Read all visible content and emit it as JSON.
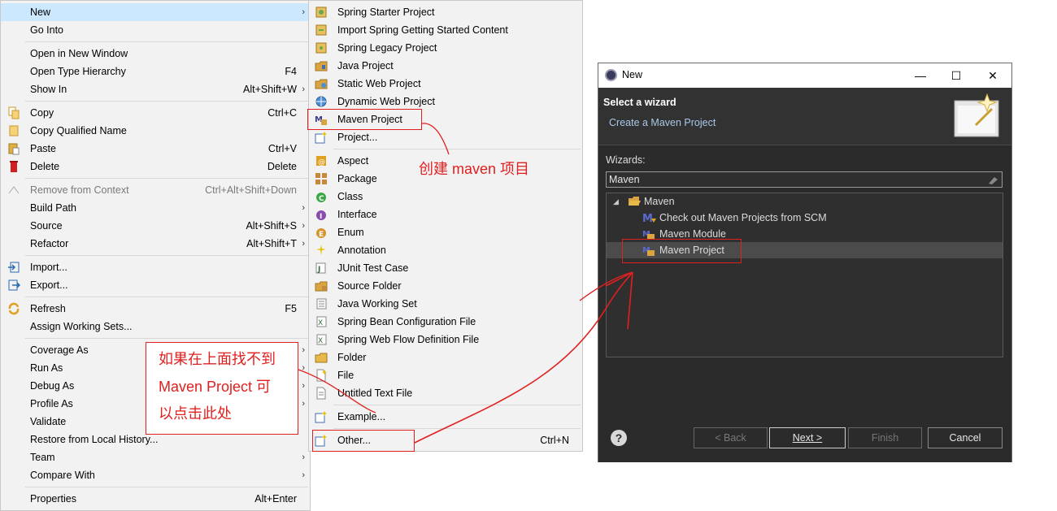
{
  "context_menu": {
    "items": [
      {
        "label": "New",
        "shortcut": "",
        "submenu": true,
        "icon": ""
      },
      {
        "label": "Go Into",
        "shortcut": "",
        "submenu": false,
        "icon": ""
      },
      {
        "label": "Open in New Window",
        "shortcut": "",
        "submenu": false,
        "icon": ""
      },
      {
        "label": "Open Type Hierarchy",
        "shortcut": "F4",
        "submenu": false,
        "icon": ""
      },
      {
        "label": "Show In",
        "shortcut": "Alt+Shift+W",
        "submenu": true,
        "icon": ""
      },
      {
        "label": "Copy",
        "shortcut": "Ctrl+C",
        "submenu": false,
        "icon": "copy-icon"
      },
      {
        "label": "Copy Qualified Name",
        "shortcut": "",
        "submenu": false,
        "icon": "copy-qualified-icon"
      },
      {
        "label": "Paste",
        "shortcut": "Ctrl+V",
        "submenu": false,
        "icon": "paste-icon"
      },
      {
        "label": "Delete",
        "shortcut": "Delete",
        "submenu": false,
        "icon": "delete-icon"
      },
      {
        "label": "Remove from Context",
        "shortcut": "Ctrl+Alt+Shift+Down",
        "submenu": false,
        "icon": "remove-context-icon",
        "disabled": true
      },
      {
        "label": "Build Path",
        "shortcut": "",
        "submenu": true,
        "icon": ""
      },
      {
        "label": "Source",
        "shortcut": "Alt+Shift+S",
        "submenu": true,
        "icon": ""
      },
      {
        "label": "Refactor",
        "shortcut": "Alt+Shift+T",
        "submenu": true,
        "icon": ""
      },
      {
        "label": "Import...",
        "shortcut": "",
        "submenu": false,
        "icon": "import-icon"
      },
      {
        "label": "Export...",
        "shortcut": "",
        "submenu": false,
        "icon": "export-icon"
      },
      {
        "label": "Refresh",
        "shortcut": "F5",
        "submenu": false,
        "icon": "refresh-icon"
      },
      {
        "label": "Assign Working Sets...",
        "shortcut": "",
        "submenu": false,
        "icon": ""
      },
      {
        "label": "Coverage As",
        "shortcut": "",
        "submenu": true,
        "icon": ""
      },
      {
        "label": "Run As",
        "shortcut": "",
        "submenu": true,
        "icon": ""
      },
      {
        "label": "Debug As",
        "shortcut": "",
        "submenu": true,
        "icon": ""
      },
      {
        "label": "Profile As",
        "shortcut": "",
        "submenu": true,
        "icon": ""
      },
      {
        "label": "Validate",
        "shortcut": "",
        "submenu": false,
        "icon": ""
      },
      {
        "label": "Restore from Local History...",
        "shortcut": "",
        "submenu": false,
        "icon": ""
      },
      {
        "label": "Team",
        "shortcut": "",
        "submenu": true,
        "icon": ""
      },
      {
        "label": "Compare With",
        "shortcut": "",
        "submenu": true,
        "icon": ""
      },
      {
        "label": "Properties",
        "shortcut": "Alt+Enter",
        "submenu": false,
        "icon": ""
      }
    ]
  },
  "new_submenu": {
    "items": [
      {
        "label": "Spring Starter Project",
        "shortcut": "",
        "icon": "spring-starter-icon"
      },
      {
        "label": "Import Spring Getting Started Content",
        "shortcut": "",
        "icon": "spring-import-icon"
      },
      {
        "label": "Spring Legacy Project",
        "shortcut": "",
        "icon": "spring-legacy-icon"
      },
      {
        "label": "Java Project",
        "shortcut": "",
        "icon": "java-project-icon"
      },
      {
        "label": "Static Web Project",
        "shortcut": "",
        "icon": "static-web-icon"
      },
      {
        "label": "Dynamic Web Project",
        "shortcut": "",
        "icon": "dynamic-web-icon"
      },
      {
        "label": "Maven Project",
        "shortcut": "",
        "icon": "maven-project-icon"
      },
      {
        "label": "Project...",
        "shortcut": "",
        "icon": "project-icon"
      },
      {
        "label": "Aspect",
        "shortcut": "",
        "icon": "aspect-icon"
      },
      {
        "label": "Package",
        "shortcut": "",
        "icon": "package-icon"
      },
      {
        "label": "Class",
        "shortcut": "",
        "icon": "class-icon"
      },
      {
        "label": "Interface",
        "shortcut": "",
        "icon": "interface-icon"
      },
      {
        "label": "Enum",
        "shortcut": "",
        "icon": "enum-icon"
      },
      {
        "label": "Annotation",
        "shortcut": "",
        "icon": "annotation-icon"
      },
      {
        "label": "JUnit Test Case",
        "shortcut": "",
        "icon": "junit-icon"
      },
      {
        "label": "Source Folder",
        "shortcut": "",
        "icon": "source-folder-icon"
      },
      {
        "label": "Java Working Set",
        "shortcut": "",
        "icon": "working-set-icon"
      },
      {
        "label": "Spring Bean Configuration File",
        "shortcut": "",
        "icon": "spring-bean-icon"
      },
      {
        "label": "Spring Web Flow Definition File",
        "shortcut": "",
        "icon": "spring-webflow-icon"
      },
      {
        "label": "Folder",
        "shortcut": "",
        "icon": "folder-icon"
      },
      {
        "label": "File",
        "shortcut": "",
        "icon": "file-icon"
      },
      {
        "label": "Untitled Text File",
        "shortcut": "",
        "icon": "text-file-icon"
      },
      {
        "label": "Example...",
        "shortcut": "",
        "icon": "example-icon"
      },
      {
        "label": "Other...",
        "shortcut": "Ctrl+N",
        "icon": "other-icon"
      }
    ]
  },
  "annotations": {
    "create_maven": "创建 maven 项目",
    "other_hint_line1": "如果在上面找不到",
    "other_hint_line2": "Maven Project 可",
    "other_hint_line3": "以点击此处"
  },
  "dialog": {
    "window_title": "New",
    "header_title": "Select a wizard",
    "header_subtitle": "Create a Maven Project",
    "wizards_label": "Wizards:",
    "filter_value": "Maven",
    "tree": {
      "root": "Maven",
      "children": [
        "Check out Maven Projects from SCM",
        "Maven Module",
        "Maven Project"
      ]
    },
    "buttons": {
      "back": "< Back",
      "next": "Next >",
      "finish": "Finish",
      "cancel": "Cancel"
    },
    "help": "?"
  },
  "colors": {
    "annotation_red": "#e02020",
    "highlight": "#cce8ff",
    "dialog_bg": "#2b2b2b"
  }
}
